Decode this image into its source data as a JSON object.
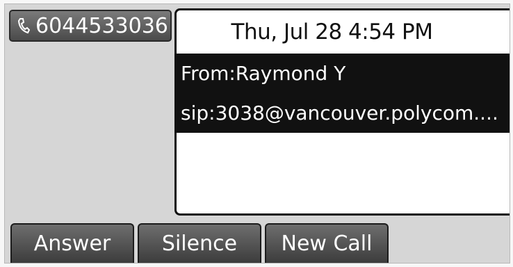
{
  "line_key": {
    "number": "6044533036",
    "icon": "phone-icon"
  },
  "status": {
    "datetime": "Thu, Jul 28  4:54 PM"
  },
  "incoming_call": {
    "from": "From:Raymond Y",
    "address": "sip:3038@vancouver.polycom...."
  },
  "softkeys": [
    {
      "label": "Answer"
    },
    {
      "label": "Silence"
    },
    {
      "label": "New Call"
    }
  ],
  "colors": {
    "highlight_bg": "#111111",
    "screen_bg": "#d6d6d6"
  }
}
